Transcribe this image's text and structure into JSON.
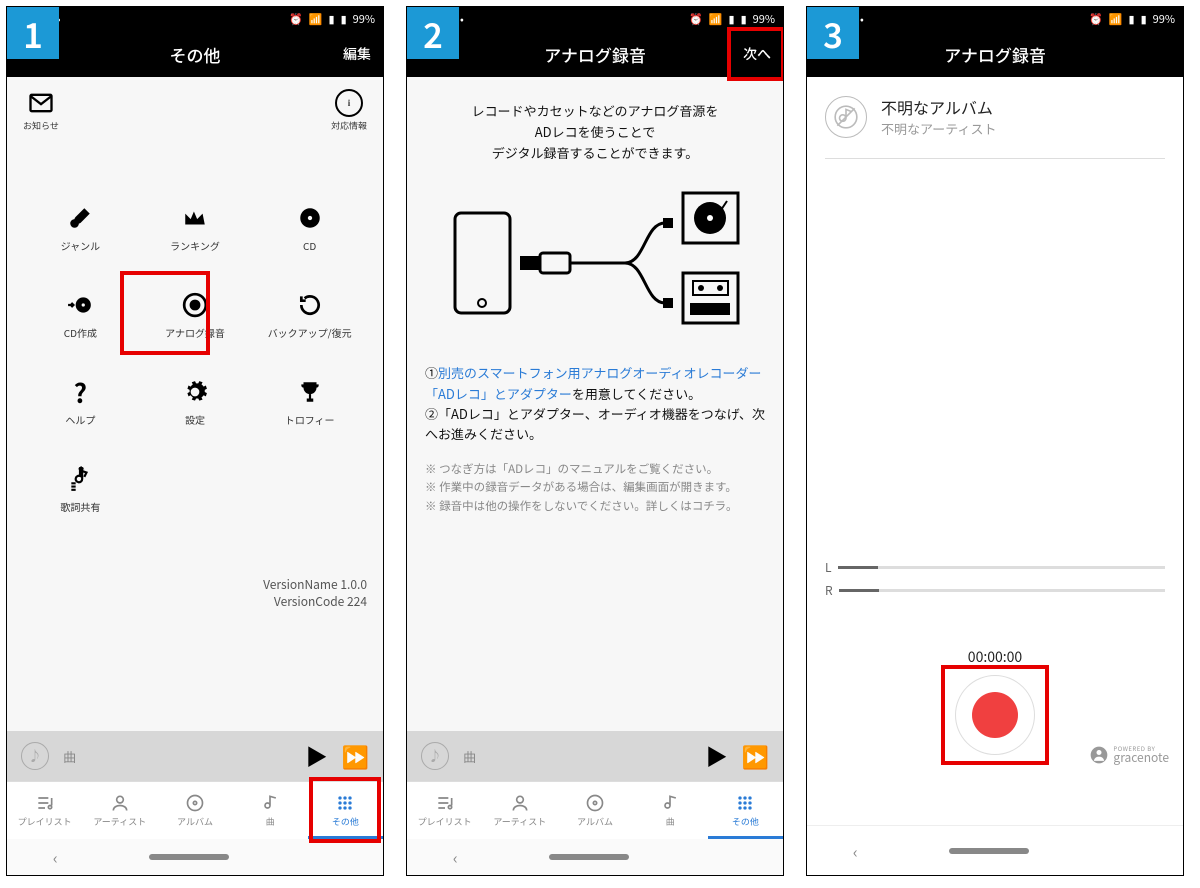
{
  "status": {
    "battery": "99%"
  },
  "screen1": {
    "title": "その他",
    "edit": "編集",
    "top_icons": {
      "notice": "お知らせ",
      "info": "対応情報"
    },
    "grid": [
      {
        "id": "genre",
        "label": "ジャンル"
      },
      {
        "id": "ranking",
        "label": "ランキング"
      },
      {
        "id": "cd",
        "label": "CD"
      },
      {
        "id": "cd-create",
        "label": "CD作成"
      },
      {
        "id": "analog-record",
        "label": "アナログ録音"
      },
      {
        "id": "backup-restore",
        "label": "バックアップ/復元"
      },
      {
        "id": "help",
        "label": "ヘルプ"
      },
      {
        "id": "settings",
        "label": "設定"
      },
      {
        "id": "trophy",
        "label": "トロフィー"
      },
      {
        "id": "lyrics-share",
        "label": "歌詞共有"
      }
    ],
    "version_name": "VersionName 1.0.0",
    "version_code": "VersionCode 224",
    "player_track": "曲",
    "bottomnav": [
      {
        "id": "playlist",
        "label": "プレイリスト"
      },
      {
        "id": "artist",
        "label": "アーティスト"
      },
      {
        "id": "album",
        "label": "アルバム"
      },
      {
        "id": "song",
        "label": "曲"
      },
      {
        "id": "other",
        "label": "その他"
      }
    ]
  },
  "screen2": {
    "title": "アナログ録音",
    "next": "次へ",
    "heading_l1": "レコードやカセットなどのアナログ音源を",
    "heading_l2": "ADレコを使うことで",
    "heading_l3": "デジタル録音することができます。",
    "instr1_prefix": "①",
    "instr1_link": "別売のスマートフォン用アナログオーディオレコーダー「ADレコ」とアダプター",
    "instr1_suffix": "を用意してください。",
    "instr2": "②「ADレコ」とアダプター、オーディオ機器をつなげ、次へお進みください。",
    "note1": "※ つなぎ方は「ADレコ」のマニュアルをご覧ください。",
    "note2": "※ 作業中の録音データがある場合は、編集画面が開きます。",
    "note3_prefix": "※ 録音中は他の操作をしないでください。詳しくは",
    "note3_link": "コチラ",
    "note3_suffix": "。",
    "player_track": "曲"
  },
  "screen3": {
    "title": "アナログ録音",
    "album": "不明なアルバム",
    "artist": "不明なアーティスト",
    "meter_l": "L",
    "meter_r": "R",
    "time": "00:00:00",
    "gracenote_small": "POWERED BY",
    "gracenote": "gracenote"
  }
}
